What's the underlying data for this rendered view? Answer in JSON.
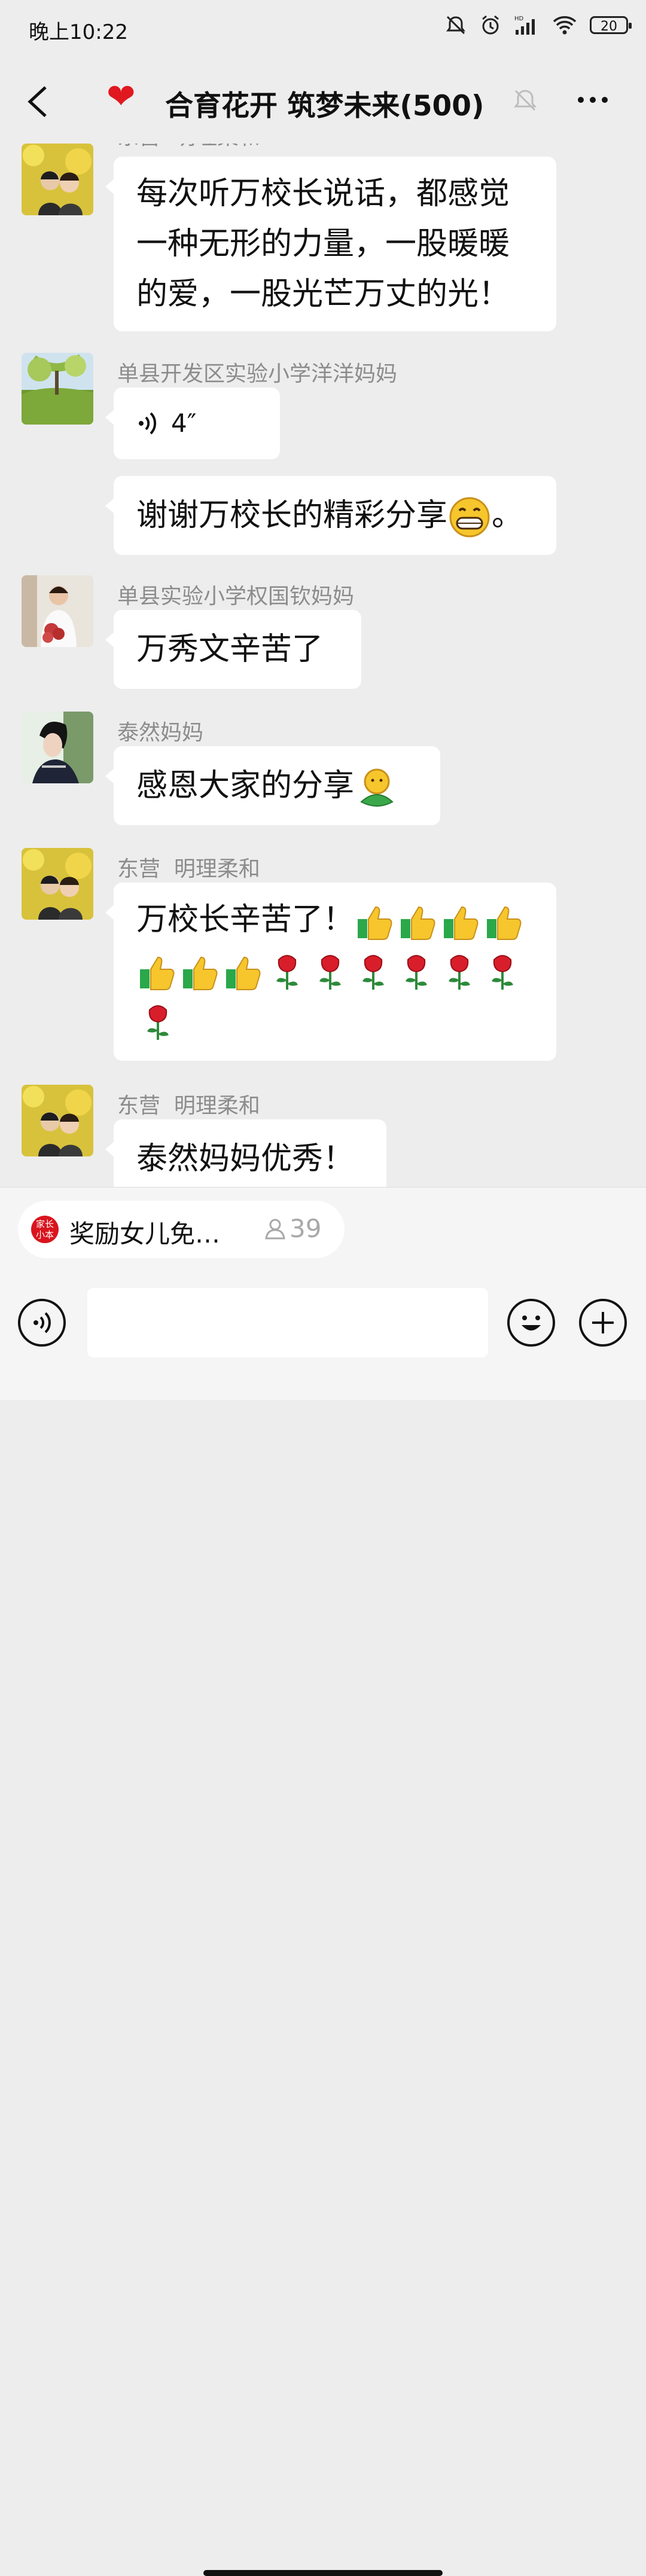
{
  "status_bar": {
    "time": "晚上10:22",
    "battery": "20",
    "network": "HD"
  },
  "header": {
    "title": "合育花开 筑梦未来(500)",
    "heart": "❤"
  },
  "messages": [
    {
      "sender": "东营  明理柔和",
      "text": "每次听万校长说话，都感觉一种无形的力量，一股暖暖的爱，一股光芒万丈的光！"
    },
    {
      "sender": "单县开发区实验小学洋洋妈妈",
      "voice_duration": "4″",
      "text": "谢谢万校长的精彩分享",
      "text_tail": "。"
    },
    {
      "sender": "单县实验小学权国钦妈妈",
      "text": "万秀文辛苦了"
    },
    {
      "sender": "泰然妈妈",
      "text": "感恩大家的分享"
    },
    {
      "sender": "东营  明理柔和",
      "text": "万校长辛苦了！"
    },
    {
      "sender": "东营  明理柔和",
      "text": "泰然妈妈优秀！"
    }
  ],
  "live_pill": {
    "logo": "家长\n小本",
    "text": "奖励女儿免…",
    "count": "39"
  },
  "colors": {
    "background": "#ededed",
    "bubble": "#ffffff",
    "sender": "#8c8c8c",
    "heart": "#e0181f"
  }
}
